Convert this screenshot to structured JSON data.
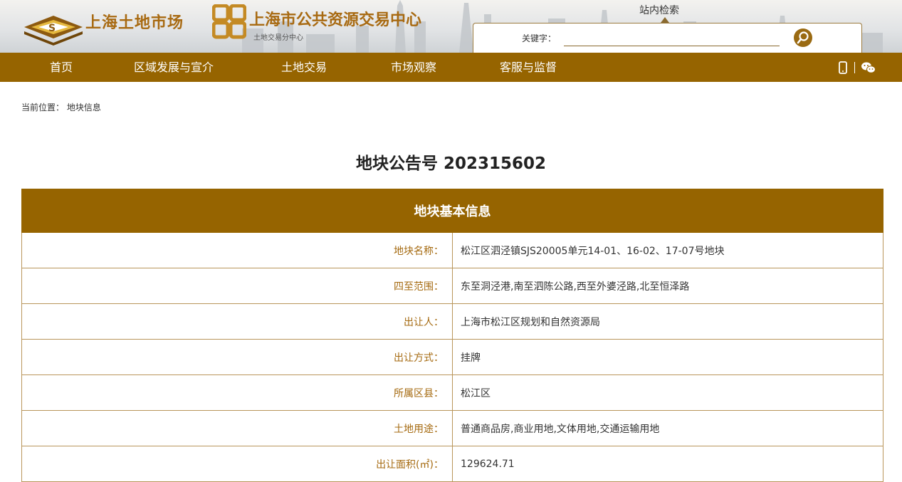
{
  "header": {
    "logo_primary_text": "上海土地市场",
    "logo_secondary_text": "上海市公共资源交易中心",
    "logo_secondary_sub": "土地交易分中心",
    "search_tab_label": "站内检索",
    "search_label": "关键字：",
    "search_value": "",
    "colors": {
      "brand": "#966400",
      "logo_text": "#a86a12"
    }
  },
  "nav": {
    "items": [
      "首页",
      "区域发展与宣介",
      "土地交易",
      "市场观察",
      "客服与监督"
    ],
    "icons": [
      "mobile-icon",
      "wechat-icon"
    ]
  },
  "breadcrumb": {
    "prefix": "当前位置：",
    "current": "地块信息"
  },
  "page_title": "地块公告号 202315602",
  "table": {
    "section_title": "地块基本信息",
    "rows": [
      {
        "label": "地块名称：",
        "value": "松江区泗泾镇SJS20005单元14-01、16-02、17-07号地块"
      },
      {
        "label": "四至范围：",
        "value": "东至洞泾港,南至泗陈公路,西至外婆泾路,北至恒泽路"
      },
      {
        "label": "出让人：",
        "value": "上海市松江区规划和自然资源局"
      },
      {
        "label": "出让方式：",
        "value": "挂牌"
      },
      {
        "label": "所属区县：",
        "value": "松江区"
      },
      {
        "label": "土地用途：",
        "value": "普通商品房,商业用地,文体用地,交通运输用地"
      },
      {
        "label": "出让面积(㎡)：",
        "value": "129624.71"
      }
    ]
  }
}
